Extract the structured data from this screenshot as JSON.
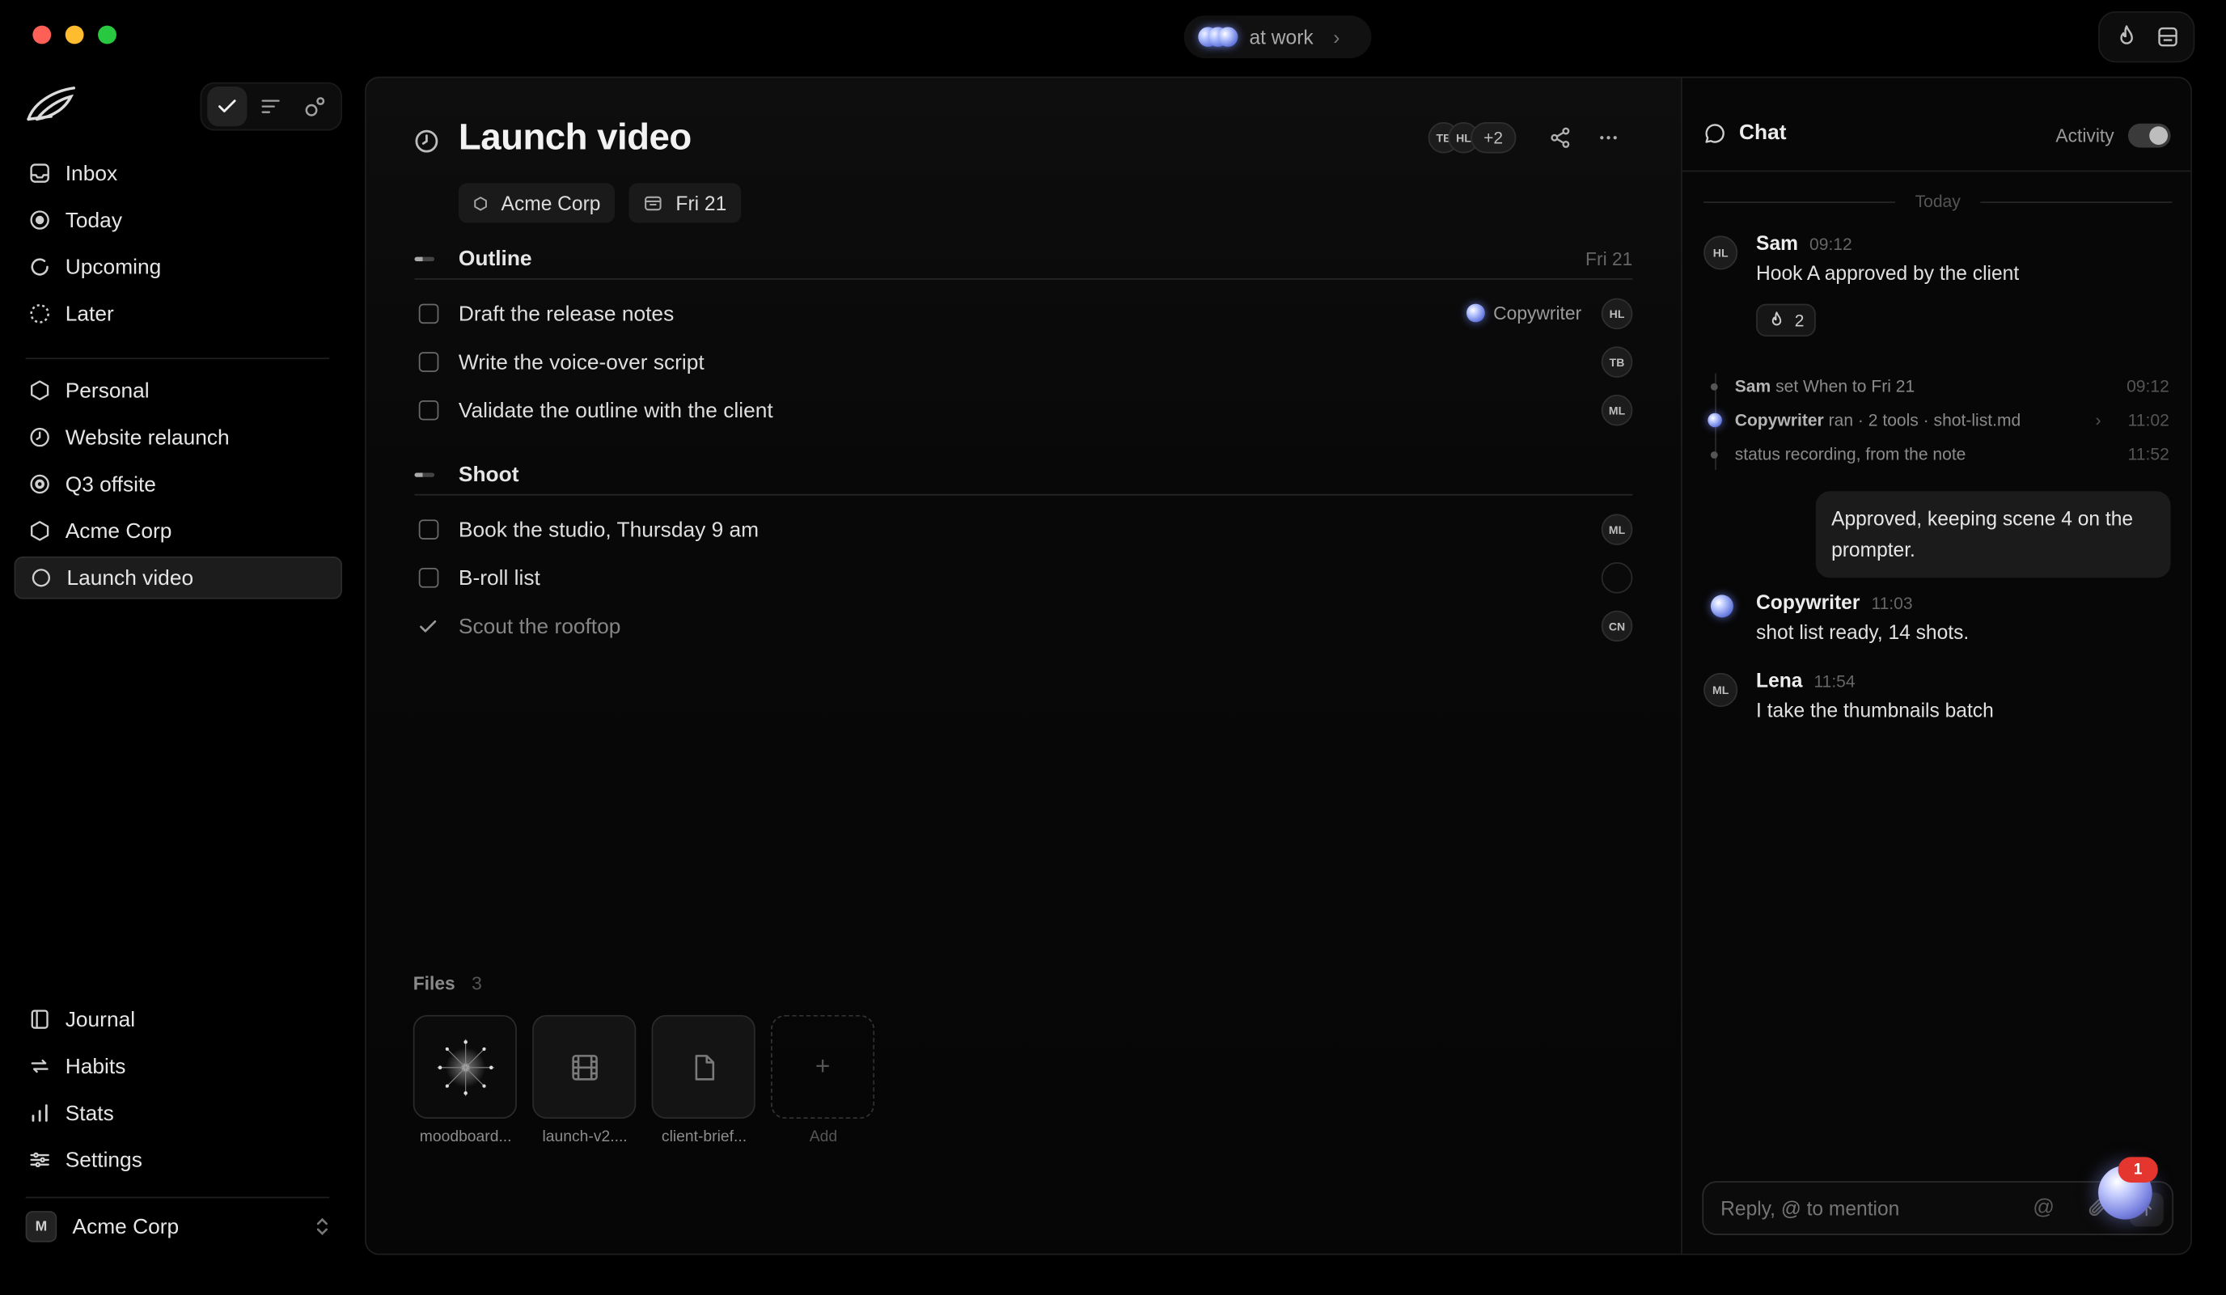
{
  "window": {
    "status_label": "at work"
  },
  "sidebar": {
    "nav": [
      {
        "label": "Inbox",
        "icon": "inbox-icon"
      },
      {
        "label": "Today",
        "icon": "today-icon"
      },
      {
        "label": "Upcoming",
        "icon": "upcoming-icon"
      },
      {
        "label": "Later",
        "icon": "later-icon"
      }
    ],
    "projects": [
      {
        "label": "Personal",
        "icon": "hexagon-icon"
      },
      {
        "label": "Website relaunch",
        "icon": "clock-icon"
      },
      {
        "label": "Q3 offsite",
        "icon": "target-icon"
      },
      {
        "label": "Acme Corp",
        "icon": "hexagon-icon"
      },
      {
        "label": "Launch video",
        "icon": "circle-icon",
        "active": true
      }
    ],
    "bottom": [
      {
        "label": "Journal",
        "icon": "journal-icon"
      },
      {
        "label": "Habits",
        "icon": "habits-icon"
      },
      {
        "label": "Stats",
        "icon": "stats-icon"
      },
      {
        "label": "Settings",
        "icon": "settings-icon"
      }
    ],
    "workspace": {
      "initial": "M",
      "name": "Acme Corp"
    }
  },
  "project": {
    "title": "Launch video",
    "chips": {
      "area": "Acme Corp",
      "date": "Fri 21"
    },
    "members": {
      "a1": "TB",
      "a2": "HL",
      "more": "+2"
    },
    "sections": [
      {
        "name": "Outline",
        "date": "Fri 21",
        "tasks": [
          {
            "text": "Draft the release notes",
            "agent": "Copywriter",
            "assignee": "HL"
          },
          {
            "text": "Write the voice-over script",
            "assignee": "TB"
          },
          {
            "text": "Validate the outline with the client",
            "assignee": "ML"
          }
        ]
      },
      {
        "name": "Shoot",
        "tasks": [
          {
            "text": "Book the studio, Thursday 9 am",
            "assignee": "ML"
          },
          {
            "text": "B-roll list",
            "assignee": ""
          },
          {
            "text": "Scout the rooftop",
            "assignee": "CN",
            "done": true
          }
        ]
      }
    ],
    "files": {
      "label": "Files",
      "count": "3",
      "items": [
        {
          "name": "moodboard..."
        },
        {
          "name": "launch-v2...."
        },
        {
          "name": "client-brief..."
        }
      ],
      "add_label": "Add"
    }
  },
  "chat": {
    "title": "Chat",
    "activity_label": "Activity",
    "activity_on": true,
    "day_label": "Today",
    "messages": {
      "m1": {
        "avatar": "HL",
        "name": "Sam",
        "time": "09:12",
        "text": "Hook A approved by the client",
        "reaction_count": "2"
      },
      "m2": {
        "name": "Copywriter",
        "time": "11:03",
        "text": "shot list ready, 14 shots."
      },
      "m3": {
        "avatar": "ML",
        "name": "Lena",
        "time": "11:54",
        "text": "I take the thumbnails batch"
      }
    },
    "activity": [
      {
        "actor": "Sam",
        "text": "set When to Fri 21",
        "time": "09:12"
      },
      {
        "actor": "Copywriter",
        "text": "ran · 2 tools · shot-list.md",
        "time": "11:02"
      },
      {
        "actor": "",
        "text": "status recording, from the note",
        "time": "11:52"
      }
    ],
    "own_message": "Approved, keeping scene 4 on the prompter.",
    "reply_placeholder": "Reply, @ to mention",
    "notification_count": "1"
  }
}
